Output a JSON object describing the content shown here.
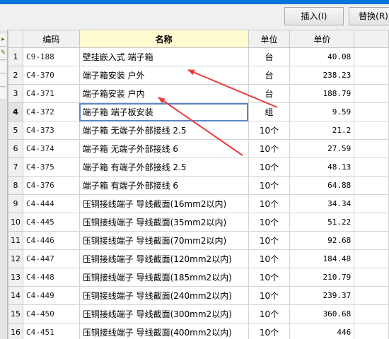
{
  "toolbar": {
    "insert_label": "插入(I)",
    "replace_label": "替换(R)"
  },
  "table": {
    "headers": [
      "",
      "编码",
      "名称",
      "单位",
      "单价",
      ""
    ],
    "rows": [
      {
        "num": "1",
        "code": "C9-188",
        "name": "壁挂嵌入式 端子箱",
        "unit": "台",
        "price": "40.08"
      },
      {
        "num": "2",
        "code": "C4-370",
        "name": "端子箱安装 户外",
        "unit": "台",
        "price": "238.23"
      },
      {
        "num": "3",
        "code": "C4-371",
        "name": "端子箱安装 户内",
        "unit": "台",
        "price": "188.79"
      },
      {
        "num": "4",
        "code": "C4-372",
        "name": "端子箱 端子板安装",
        "unit": "组",
        "price": "9.59"
      },
      {
        "num": "5",
        "code": "C4-373",
        "name": "端子箱 无端子外部接线 2.5",
        "unit": "10个",
        "price": "21.2"
      },
      {
        "num": "6",
        "code": "C4-374",
        "name": "端子箱 无端子外部接线 6",
        "unit": "10个",
        "price": "27.59"
      },
      {
        "num": "7",
        "code": "C4-375",
        "name": "端子箱 有端子外部接线 2.5",
        "unit": "10个",
        "price": "48.13"
      },
      {
        "num": "8",
        "code": "C4-376",
        "name": "端子箱 有端子外部接线 6",
        "unit": "10个",
        "price": "64.88"
      },
      {
        "num": "9",
        "code": "C4-444",
        "name": "压铜接线端子 导线截面(16mm2以内)",
        "unit": "10个",
        "price": "34.34"
      },
      {
        "num": "10",
        "code": "C4-445",
        "name": "压铜接线端子 导线截面(35mm2以内)",
        "unit": "10个",
        "price": "51.22"
      },
      {
        "num": "11",
        "code": "C4-446",
        "name": "压铜接线端子 导线截面(70mm2以内)",
        "unit": "10个",
        "price": "92.68"
      },
      {
        "num": "12",
        "code": "C4-447",
        "name": "压铜接线端子 导线截面(120mm2以内)",
        "unit": "10个",
        "price": "184.48"
      },
      {
        "num": "13",
        "code": "C4-448",
        "name": "压铜接线端子 导线截面(185mm2以内)",
        "unit": "10个",
        "price": "210.79"
      },
      {
        "num": "14",
        "code": "C4-449",
        "name": "压铜接线端子 导线截面(240mm2以内)",
        "unit": "10个",
        "price": "239.37"
      },
      {
        "num": "15",
        "code": "C4-450",
        "name": "压铜接线端子 导线截面(300mm2以内)",
        "unit": "10个",
        "price": "360.68"
      },
      {
        "num": "16",
        "code": "C4-451",
        "name": "压铜接线端子 导线截面(400mm2以内)",
        "unit": "10个",
        "price": "446"
      }
    ]
  },
  "selected_row": "4",
  "colors": {
    "accent": "#0a74d8",
    "header_highlight": "#fefbd0",
    "annotation": "#e83a3a",
    "selection": "#5b86c8"
  }
}
